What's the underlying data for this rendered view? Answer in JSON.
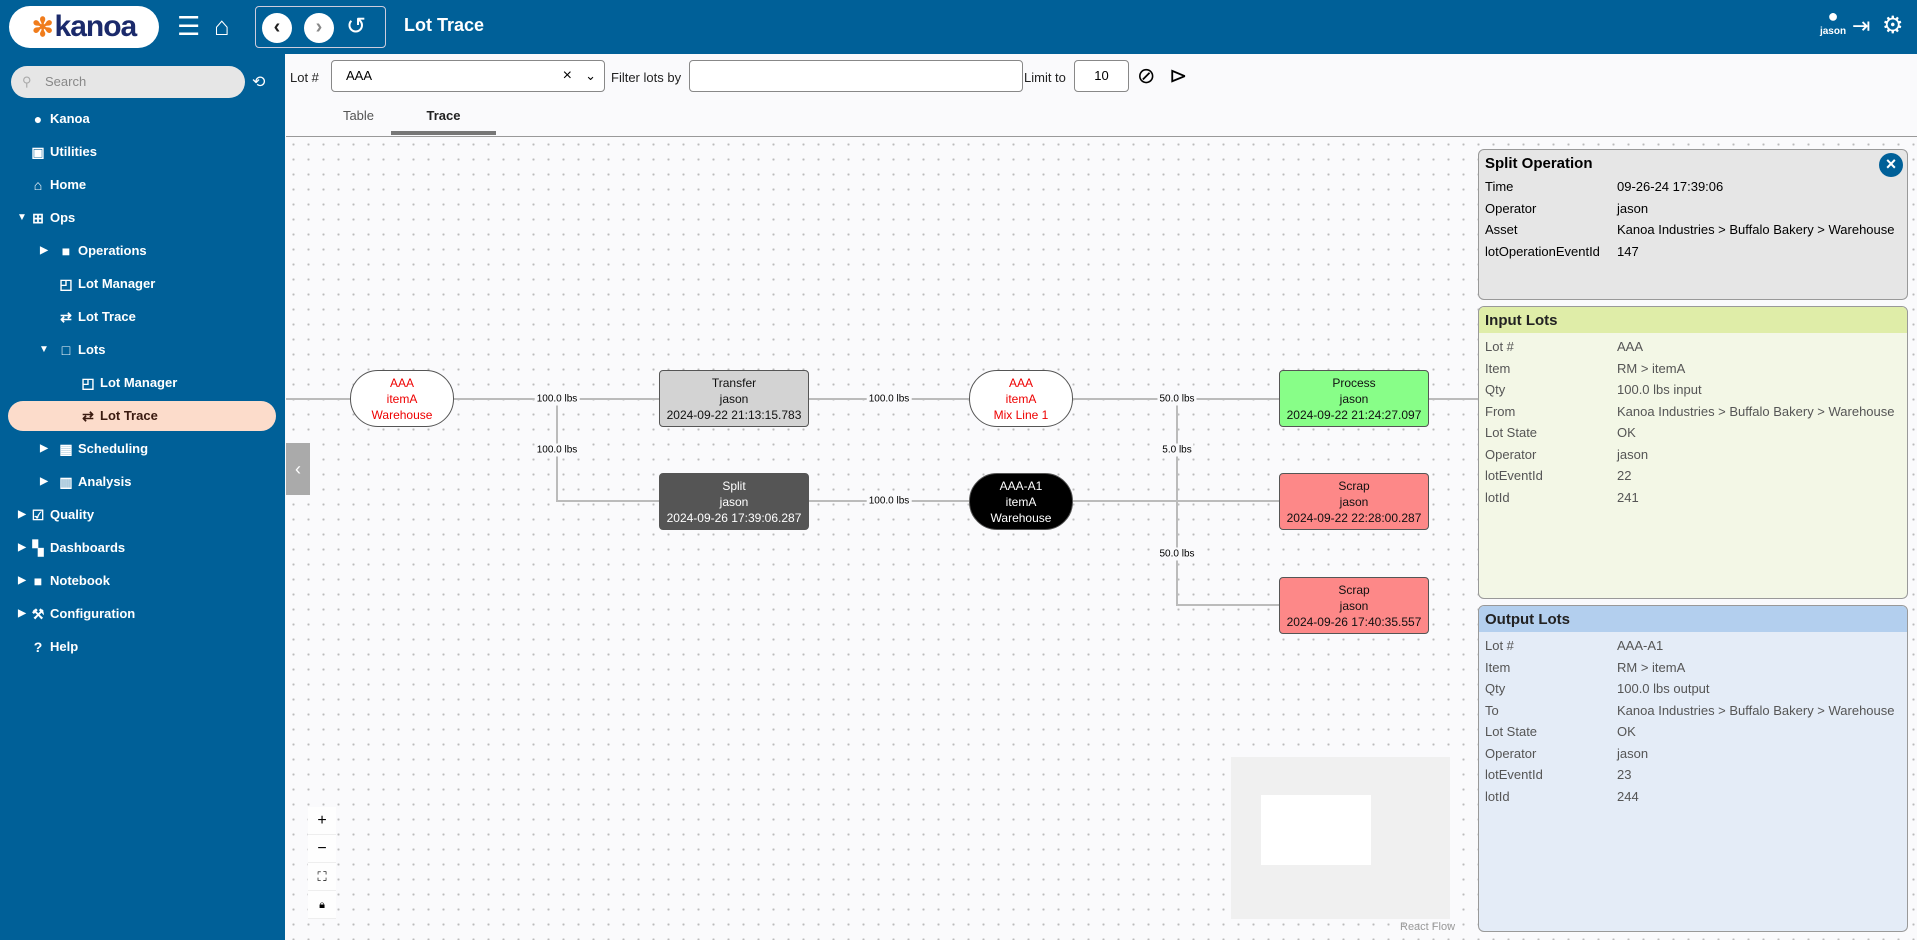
{
  "header": {
    "logo": "kanoa",
    "title": "Lot Trace",
    "user": "jason"
  },
  "sidebar": {
    "search_placeholder": "Search",
    "items": [
      {
        "label": "Kanoa",
        "icon": "kanoa-icon",
        "level": 0,
        "caret": ""
      },
      {
        "label": "Utilities",
        "icon": "utilities-icon",
        "level": 0,
        "caret": ""
      },
      {
        "label": "Home",
        "icon": "home-icon",
        "level": 0,
        "caret": ""
      },
      {
        "label": "Ops",
        "icon": "ops-icon",
        "level": 0,
        "caret": "down"
      },
      {
        "label": "Operations",
        "icon": "folder-icon",
        "level": 1,
        "caret": "right"
      },
      {
        "label": "Lot Manager",
        "icon": "lot-manager-icon",
        "level": 1,
        "caret": ""
      },
      {
        "label": "Lot Trace",
        "icon": "lot-trace-icon",
        "level": 1,
        "caret": ""
      },
      {
        "label": "Lots",
        "icon": "square-icon",
        "level": 1,
        "caret": "down"
      },
      {
        "label": "Lot Manager",
        "icon": "lot-manager-icon",
        "level": 2,
        "caret": ""
      },
      {
        "label": "Lot Trace",
        "icon": "lot-trace-icon",
        "level": 2,
        "caret": "",
        "active": true
      },
      {
        "label": "Scheduling",
        "icon": "calendar-icon",
        "level": 1,
        "caret": "right"
      },
      {
        "label": "Analysis",
        "icon": "chart-icon",
        "level": 1,
        "caret": "right"
      },
      {
        "label": "Quality",
        "icon": "quality-icon",
        "level": 0,
        "caret": "right"
      },
      {
        "label": "Dashboards",
        "icon": "dashboard-icon",
        "level": 0,
        "caret": "right"
      },
      {
        "label": "Notebook",
        "icon": "folder-icon",
        "level": 0,
        "caret": "right"
      },
      {
        "label": "Configuration",
        "icon": "tools-icon",
        "level": 0,
        "caret": "right"
      },
      {
        "label": "Help",
        "icon": "help-icon",
        "level": 0,
        "caret": ""
      }
    ]
  },
  "toolbar": {
    "lot_label": "Lot #",
    "lot_value": "AAA",
    "filter_label": "Filter lots by",
    "filter_value": "",
    "limit_label": "Limit to",
    "limit_value": "10"
  },
  "tabs": [
    {
      "label": "Table"
    },
    {
      "label": "Trace",
      "active": true
    }
  ],
  "graph": {
    "nodes": [
      {
        "id": "lot1",
        "type": "lot",
        "lines": [
          "AAA",
          "itemA",
          "Warehouse"
        ]
      },
      {
        "id": "transfer",
        "type": "op",
        "lines": [
          "Transfer",
          "jason",
          "2024-09-22 21:13:15.783"
        ],
        "color": "#d3d3d3"
      },
      {
        "id": "lot2",
        "type": "lot",
        "lines": [
          "AAA",
          "itemA",
          "Mix Line 1"
        ]
      },
      {
        "id": "process",
        "type": "op",
        "lines": [
          "Process",
          "jason",
          "2024-09-22 21:24:27.097"
        ],
        "color": "#88fe88"
      },
      {
        "id": "split",
        "type": "op",
        "lines": [
          "Split",
          "jason",
          "2024-09-26 17:39:06.287"
        ],
        "color": "#555555"
      },
      {
        "id": "lot3",
        "type": "lot",
        "lines": [
          "AAA-A1",
          "itemA",
          "Warehouse"
        ],
        "color": "#000000"
      },
      {
        "id": "scrap1",
        "type": "op",
        "lines": [
          "Scrap",
          "jason",
          "2024-09-22 22:28:00.287"
        ],
        "color": "#fd8888"
      },
      {
        "id": "scrap2",
        "type": "op",
        "lines": [
          "Scrap",
          "jason",
          "2024-09-26 17:40:35.557"
        ],
        "color": "#fd8888"
      }
    ],
    "edge_labels": [
      "100.0 lbs",
      "100.0 lbs",
      "100.0 lbs",
      "50.0 lbs",
      "5.0 lbs",
      "100.0 lbs",
      "50.0 lbs"
    ],
    "attribution": "React Flow"
  },
  "split_operation": {
    "title": "Split Operation",
    "rows": [
      [
        "Time",
        "09-26-24 17:39:06"
      ],
      [
        "Operator",
        "jason"
      ],
      [
        "Asset",
        "Kanoa Industries > Buffalo Bakery > Warehouse"
      ],
      [
        "lotOperationEventId",
        "147"
      ]
    ]
  },
  "input_lots": {
    "title": "Input Lots",
    "rows": [
      [
        "Lot #",
        "AAA"
      ],
      [
        "Item",
        "RM > itemA"
      ],
      [
        "Qty",
        "100.0 lbs input"
      ],
      [
        "From",
        "Kanoa Industries > Buffalo Bakery > Warehouse"
      ],
      [
        "Lot State",
        "OK"
      ],
      [
        "Operator",
        "jason"
      ],
      [
        "lotEventId",
        "22"
      ],
      [
        "lotId",
        "241"
      ]
    ]
  },
  "output_lots": {
    "title": "Output Lots",
    "rows": [
      [
        "Lot #",
        "AAA-A1"
      ],
      [
        "Item",
        "RM > itemA"
      ],
      [
        "Qty",
        "100.0 lbs output"
      ],
      [
        "To",
        "Kanoa Industries > Buffalo Bakery > Warehouse"
      ],
      [
        "Lot State",
        "OK"
      ],
      [
        "Operator",
        "jason"
      ],
      [
        "lotEventId",
        "23"
      ],
      [
        "lotId",
        "244"
      ]
    ]
  }
}
